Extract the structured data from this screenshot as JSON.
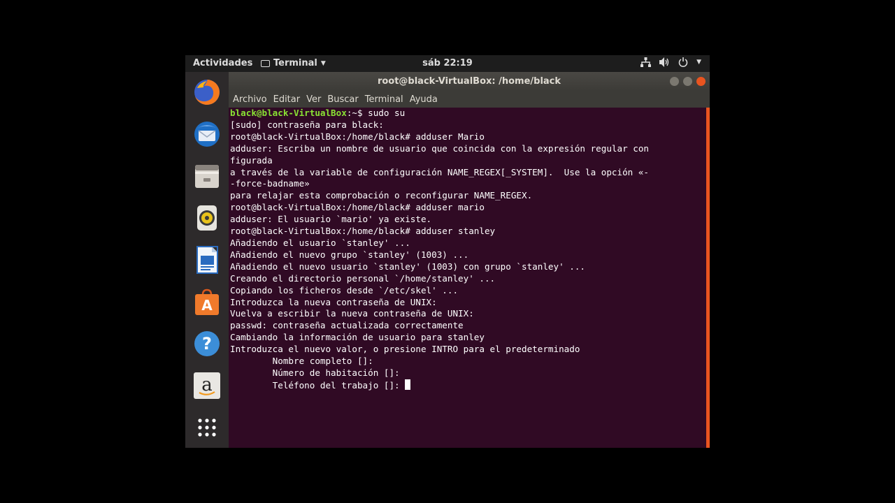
{
  "topbar": {
    "activities": "Actividades",
    "app_name": "Terminal",
    "clock": "sáb 22:19"
  },
  "dock": {
    "items": [
      "firefox-icon",
      "thunderbird-icon",
      "files-icon",
      "rhythmbox-icon",
      "libreoffice-writer-icon",
      "software-center-icon",
      "help-icon",
      "amazon-icon",
      "show-apps-icon"
    ]
  },
  "window": {
    "title": "root@black-VirtualBox: /home/black",
    "menu": [
      "Archivo",
      "Editar",
      "Ver",
      "Buscar",
      "Terminal",
      "Ayuda"
    ]
  },
  "terminal": {
    "prompt_user": "black@black-VirtualBox",
    "prompt_rest": ":~$ sudo su",
    "lines": [
      "[sudo] contraseña para black:",
      "root@black-VirtualBox:/home/black# adduser Mario",
      "adduser: Escriba un nombre de usuario que coincida con la expresión regular con",
      "figurada",
      "a través de la variable de configuración NAME_REGEX[_SYSTEM].  Use la opción «-",
      "-force-badname»",
      "para relajar esta comprobación o reconfigurar NAME_REGEX.",
      "root@black-VirtualBox:/home/black# adduser mario",
      "adduser: El usuario `mario' ya existe.",
      "root@black-VirtualBox:/home/black# adduser stanley",
      "Añadiendo el usuario `stanley' ...",
      "Añadiendo el nuevo grupo `stanley' (1003) ...",
      "Añadiendo el nuevo usuario `stanley' (1003) con grupo `stanley' ...",
      "Creando el directorio personal `/home/stanley' ...",
      "Copiando los ficheros desde `/etc/skel' ...",
      "Introduzca la nueva contraseña de UNIX:",
      "Vuelva a escribir la nueva contraseña de UNIX:",
      "passwd: contraseña actualizada correctamente",
      "Cambiando la información de usuario para stanley",
      "Introduzca el nuevo valor, o presione INTRO para el predeterminado",
      "        Nombre completo []:",
      "        Número de habitación []:"
    ],
    "current_line": "        Teléfono del trabajo []: "
  },
  "colors": {
    "terminal_bg": "#300a24",
    "prompt_green": "#8ae234",
    "accent_orange": "#e95420"
  }
}
